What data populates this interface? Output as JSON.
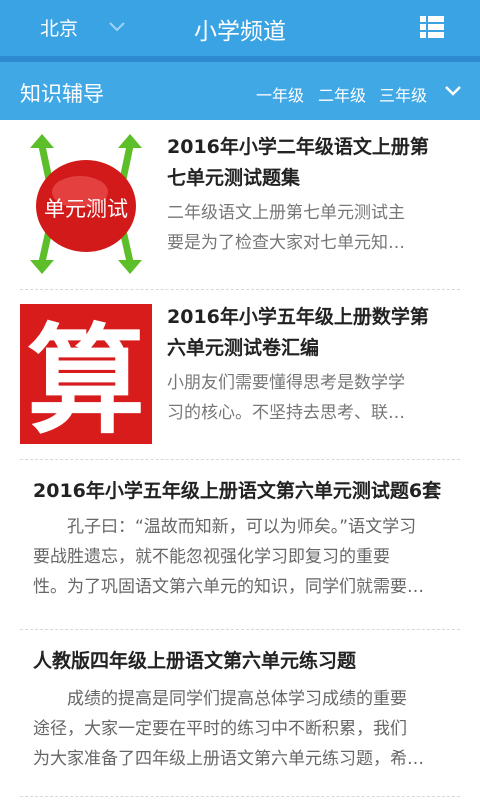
{
  "header": {
    "city": "北京",
    "title": "小学频道"
  },
  "subheader": {
    "section": "知识辅导",
    "grades": [
      "一年级",
      "二年级",
      "三年级"
    ]
  },
  "articles": [
    {
      "title_line1": "2016年小学二年级语文上册第",
      "title_line2": "七单元测试题集",
      "summary_line1": "二年级语文上册第七单元测试主",
      "summary_line2": "要是为了检查大家对七单元知…",
      "thumb_text": "单元测试"
    },
    {
      "title_line1": "2016年小学五年级上册数学第",
      "title_line2": "六单元测试卷汇编",
      "summary_line1": "小朋友们需要懂得思考是数学学",
      "summary_line2": "习的核心。不坚持去思考、联…",
      "thumb_text": "算"
    },
    {
      "title": "2016年小学五年级上册语文第六单元测试题6套",
      "summary_line1": "孔子曰：“温故而知新，可以为师矣。”语文学习",
      "summary_line2": "要战胜遗忘，就不能忽视强化学习即复习的重要",
      "summary_line3": "性。为了巩固语文第六单元的知识，同学们就需要…"
    },
    {
      "title": "人教版四年级上册语文第六单元练习题",
      "summary_line1": "成绩的提高是同学们提高总体学习成绩的重要",
      "summary_line2": "途径，大家一定要在平时的练习中不断积累，我们",
      "summary_line3": "为大家准备了四年级上册语文第六单元练习题，希…"
    }
  ]
}
